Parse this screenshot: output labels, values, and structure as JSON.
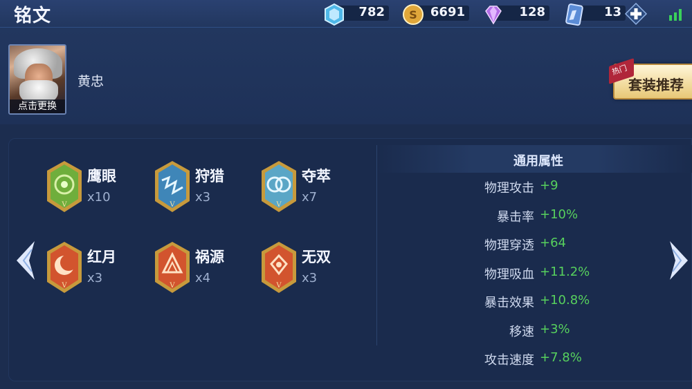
{
  "header": {
    "title": "铭文",
    "currencies": [
      {
        "icon": "crystal-icon",
        "value": "782"
      },
      {
        "icon": "gold-coin-icon",
        "value": "6691"
      },
      {
        "icon": "diamond-icon",
        "value": "128"
      },
      {
        "icon": "voucher-card-icon",
        "value": "13"
      }
    ]
  },
  "hero": {
    "name": "黄忠",
    "change_label": "点击更换"
  },
  "recommend": {
    "badge": "热门",
    "label": "套装推荐"
  },
  "runes": [
    {
      "name": "鹰眼",
      "count": "x10",
      "color": "#6fae3c",
      "icon": "hawkeye-rune-icon"
    },
    {
      "name": "狩猎",
      "count": "x3",
      "color": "#3f86b8",
      "icon": "hunt-rune-icon"
    },
    {
      "name": "夺萃",
      "count": "x7",
      "color": "#5aa6c6",
      "icon": "plunder-rune-icon"
    },
    {
      "name": "红月",
      "count": "x3",
      "color": "#d2542e",
      "icon": "red-moon-rune-icon"
    },
    {
      "name": "祸源",
      "count": "x4",
      "color": "#d2542e",
      "icon": "calamity-rune-icon"
    },
    {
      "name": "无双",
      "count": "x3",
      "color": "#d2542e",
      "icon": "peerless-rune-icon"
    }
  ],
  "stats": {
    "title": "通用属性",
    "items": [
      {
        "label": "物理攻击",
        "value": "+9"
      },
      {
        "label": "暴击率",
        "value": "+10%"
      },
      {
        "label": "物理穿透",
        "value": "+64"
      },
      {
        "label": "物理吸血",
        "value": "+11.2%"
      },
      {
        "label": "暴击效果",
        "value": "+10.8%"
      },
      {
        "label": "移速",
        "value": "+3%"
      },
      {
        "label": "攻击速度",
        "value": "+7.8%"
      }
    ]
  }
}
